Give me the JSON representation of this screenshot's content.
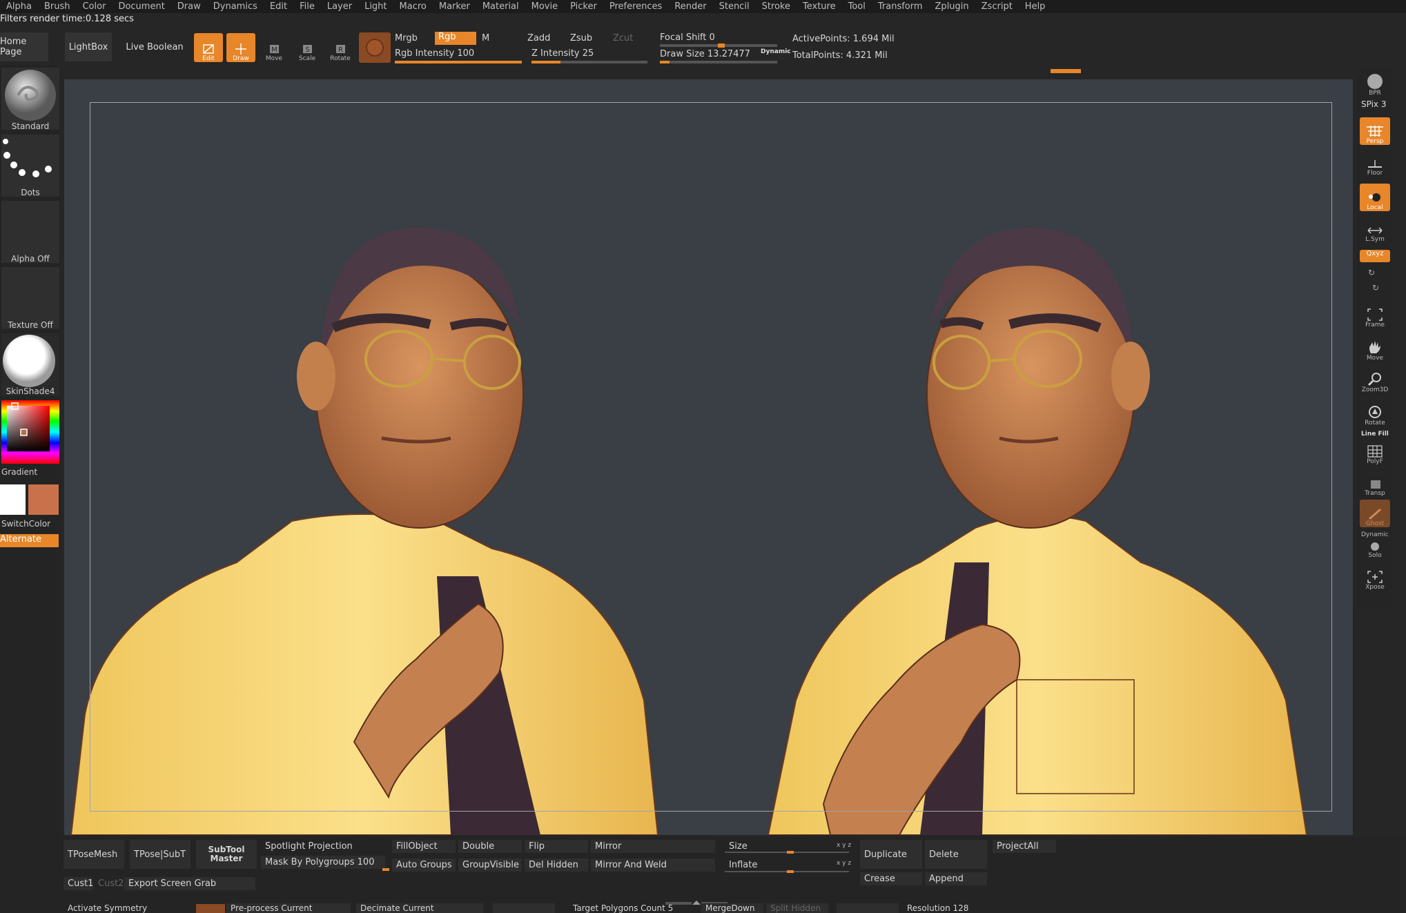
{
  "menu": [
    "Alpha",
    "Brush",
    "Color",
    "Document",
    "Draw",
    "Dynamics",
    "Edit",
    "File",
    "Layer",
    "Light",
    "Macro",
    "Marker",
    "Material",
    "Movie",
    "Picker",
    "Preferences",
    "Render",
    "Stencil",
    "Stroke",
    "Texture",
    "Tool",
    "Transform",
    "Zplugin",
    "Zscript",
    "Help"
  ],
  "status": "Filters render time:0.128 secs",
  "toolbar": {
    "home_page": "Home Page",
    "lightbox": "LightBox",
    "live_boolean": "Live Boolean",
    "edit": "Edit",
    "draw": "Draw",
    "move": "Move",
    "scale": "Scale",
    "rotate": "Rotate",
    "mrgb": "Mrgb",
    "rgb": "Rgb",
    "m": "M",
    "rgb_intensity": "Rgb Intensity 100",
    "rgb_intensity_value": 100,
    "zadd": "Zadd",
    "zsub": "Zsub",
    "zcut": "Zcut",
    "z_intensity": "Z Intensity 25",
    "z_intensity_value": 25,
    "focal_shift": "Focal Shift 0",
    "draw_size": "Draw Size 13.27477",
    "dynamic": "Dynamic",
    "active_points": "ActivePoints: 1.694 Mil",
    "total_points": "TotalPoints: 4.321 Mil"
  },
  "left_panel": {
    "brush": "Standard",
    "stroke": "Dots",
    "alpha": "Alpha Off",
    "texture": "Texture Off",
    "material": "SkinShade4",
    "gradient": "Gradient",
    "switch_color": "SwitchColor",
    "alternate": "Alternate",
    "main_color": "#ffffff",
    "secondary_color": "#c9714a"
  },
  "right_shelf": {
    "bpr": "BPR",
    "spix": "SPix 3",
    "persp": "Persp",
    "floor": "Floor",
    "local": "Local",
    "lsym": "L.Sym",
    "xyz": "Qxyz",
    "frame": "Frame",
    "move": "Move",
    "zoom3d": "Zoom3D",
    "rotate": "Rotate",
    "line_fill": "Line Fill",
    "polyf": "PolyF",
    "transp": "Transp",
    "ghost": "Ghost",
    "dynamic": "Dynamic",
    "solo": "Solo",
    "xpose": "Xpose"
  },
  "bottom": {
    "tposemesh": "TPoseMesh",
    "tpose_subt": "TPose|SubT",
    "subtool_master": "SubTool Master",
    "spotlight_projection": "Spotlight Projection",
    "mask_by_polygroups": "Mask By Polygroups 100",
    "fill_object": "FillObject",
    "double": "Double",
    "flip": "Flip",
    "mirror": "Mirror",
    "auto_groups": "Auto Groups",
    "group_visible": "GroupVisible",
    "del_hidden": "Del Hidden",
    "mirror_and_weld": "Mirror And Weld",
    "size": "Size",
    "inflate": "Inflate",
    "xyz": "x y z",
    "duplicate": "Duplicate",
    "delete": "Delete",
    "project_all": "ProjectAll",
    "crease": "Crease",
    "append": "Append",
    "cust1": "Cust1",
    "cust2": "Cust2",
    "export_screen_grab": "Export Screen Grab",
    "activate_symmetry": "Activate Symmetry",
    "preprocess_current": "Pre-process Current",
    "decimate_current": "Decimate Current",
    "target_polygons": "Target Polygons Count 5",
    "merge_down": "MergeDown",
    "split_hidden": "Split Hidden",
    "resolution": "Resolution 128"
  },
  "colors": {
    "accent": "#e8862a"
  }
}
